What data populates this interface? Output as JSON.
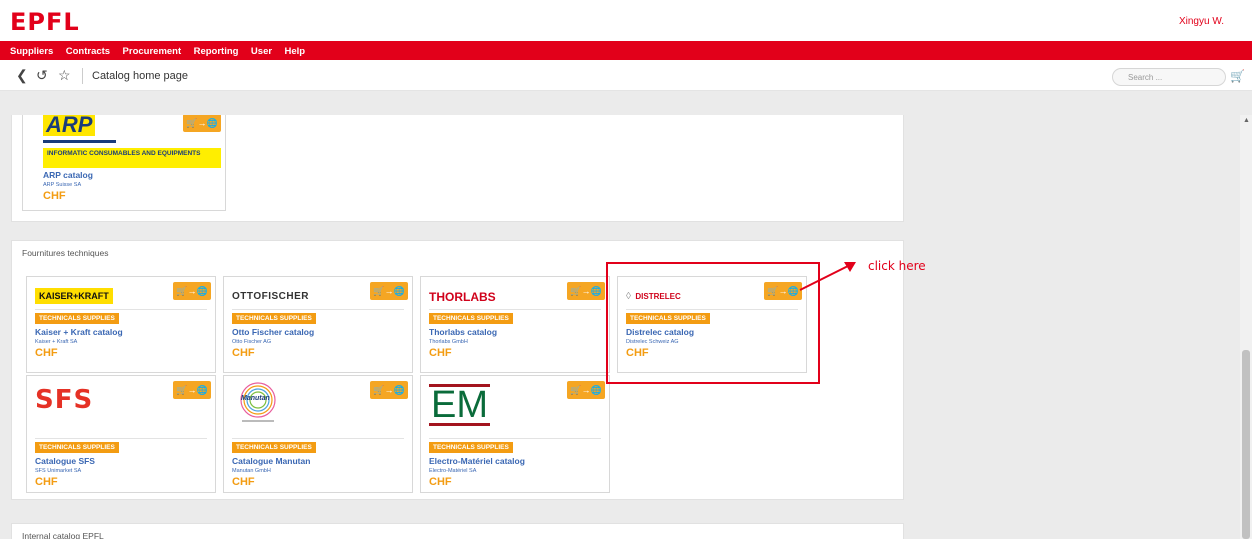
{
  "header": {
    "logo": "EPFL",
    "user": "Xingyu W."
  },
  "menu": [
    "Suppliers",
    "Contracts",
    "Procurement",
    "Reporting",
    "User",
    "Help"
  ],
  "toolbar": {
    "page_title": "Catalog home page",
    "search_placeholder": "Search ...",
    "icons": [
      "back-icon",
      "history-icon",
      "star-icon",
      "cart-icon"
    ]
  },
  "colors": {
    "brand": "#e2001a",
    "accent": "#f39c12",
    "link": "#3a67b3"
  },
  "sections": {
    "top_card": {
      "logo_text": "ARP",
      "category": "INFORMATIC CONSUMABLES AND EQUIPMENTS",
      "name": "ARP catalog",
      "supplier": "ARP Suisse SA",
      "currency": "CHF"
    },
    "technical": {
      "title": "Fournitures techniques",
      "cards": [
        {
          "logo_text": "KAISER+KRAFT",
          "tag": "TECHNICALS SUPPLIES",
          "name": "Kaiser + Kraft catalog",
          "supplier": "Kaiser + Kraft SA",
          "currency": "CHF"
        },
        {
          "logo_text": "OTTOFISCHER",
          "tag": "TECHNICALS SUPPLIES",
          "name": "Otto Fischer catalog",
          "supplier": "Otto Fischer AG",
          "currency": "CHF"
        },
        {
          "logo_text": "THORLABS",
          "tag": "TECHNICALS SUPPLIES",
          "name": "Thorlabs catalog",
          "supplier": "Thorlabs GmbH",
          "currency": "CHF"
        },
        {
          "logo_text": "DISTRELEC",
          "tag": "TECHNICALS SUPPLIES",
          "name": "Distrelec catalog",
          "supplier": "Distrelec Schweiz AG",
          "currency": "CHF"
        },
        {
          "logo_text": "SFS",
          "tag": "TECHNICALS SUPPLIES",
          "name": "Catalogue SFS",
          "supplier": "SFS Unimarket SA",
          "currency": "CHF"
        },
        {
          "logo_text": "Manutan",
          "tag": "TECHNICALS SUPPLIES",
          "name": "Catalogue Manutan",
          "supplier": "Manutan GmbH",
          "currency": "CHF"
        },
        {
          "logo_text": "EM",
          "tag": "TECHNICALS SUPPLIES",
          "name": "Electro-Matériel catalog",
          "supplier": "Electro-Matériel SA",
          "currency": "CHF"
        }
      ]
    },
    "internal": {
      "title": "Internal catalog EPFL"
    }
  },
  "annotation": {
    "text": "click here"
  }
}
